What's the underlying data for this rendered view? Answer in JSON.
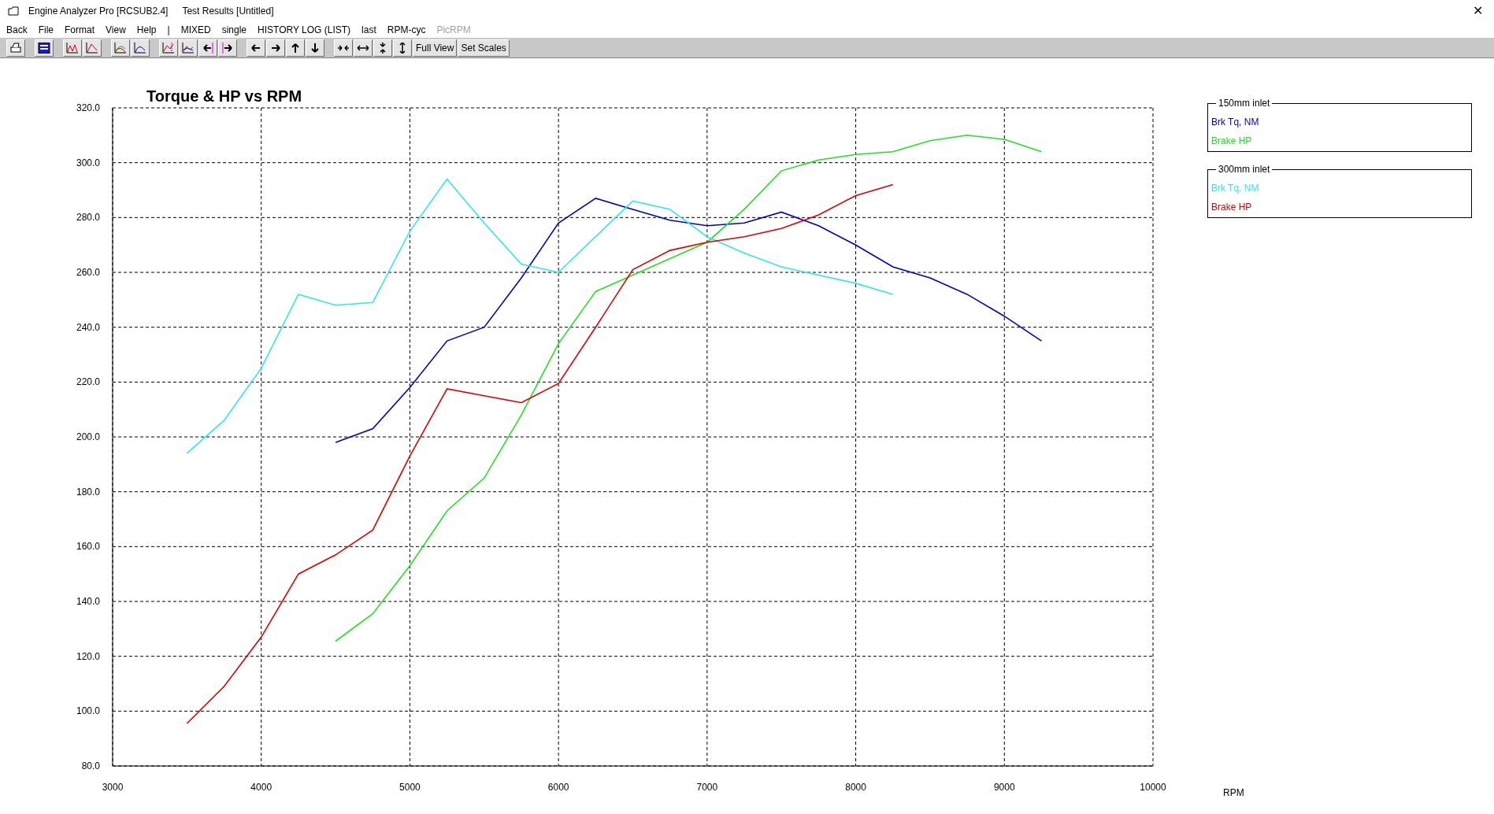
{
  "window": {
    "title": "Engine Analyzer Pro [RCSUB2.4]",
    "subtitle": "Test Results [Untitled]",
    "close": "✕"
  },
  "menu": [
    {
      "label": "Back",
      "disabled": false
    },
    {
      "label": "File",
      "disabled": false
    },
    {
      "label": "Format",
      "disabled": false
    },
    {
      "label": "View",
      "disabled": false
    },
    {
      "label": "Help",
      "disabled": false
    },
    {
      "label": "|",
      "disabled": false
    },
    {
      "label": "MIXED",
      "disabled": false
    },
    {
      "label": "single",
      "disabled": false
    },
    {
      "label": "HISTORY LOG (LIST)",
      "disabled": false
    },
    {
      "label": "last",
      "disabled": false
    },
    {
      "label": "RPM-cyc",
      "disabled": false
    },
    {
      "label": "PicRPM",
      "disabled": true
    }
  ],
  "toolbar": {
    "text_buttons": [
      "Full View",
      "Set Scales"
    ]
  },
  "legend_groups": [
    {
      "title": "150mm inlet"
    },
    {
      "title": "300mm inlet"
    }
  ],
  "chart_data": {
    "type": "line",
    "title": "Torque & HP vs RPM",
    "grid": true,
    "annotations": [
      {
        "text": "RPM"
      }
    ],
    "x": [
      3500,
      3750,
      4000,
      4250,
      4500,
      4750,
      5000,
      5250,
      5500,
      5750,
      6000,
      6250,
      6500,
      6750,
      7000,
      7250,
      7500,
      7750,
      8000,
      8250,
      8500,
      8750,
      9000,
      9250
    ],
    "series": [
      {
        "name": "Brk Tq, NM",
        "color": "#0000c8",
        "values": [
          null,
          null,
          null,
          null,
          198,
          203,
          218,
          235,
          240,
          258,
          278,
          287,
          283,
          279,
          277,
          278,
          282,
          277,
          270,
          262,
          258,
          252,
          244,
          235
        ]
      },
      {
        "name": "Brake HP",
        "color": "#22e022",
        "values": [
          null,
          null,
          null,
          null,
          125.5,
          135.5,
          153,
          173,
          185,
          208,
          234,
          253,
          259,
          265,
          271,
          283,
          297,
          301,
          303,
          304,
          308,
          310,
          308.5,
          304
        ]
      },
      {
        "name": "Brk Tq, NM",
        "color": "#33e6e6",
        "values": [
          194,
          206,
          225,
          252,
          248,
          249,
          275,
          294,
          278,
          263,
          260,
          273,
          286,
          283,
          273,
          267,
          262,
          259,
          256,
          252,
          null,
          null,
          null,
          null
        ]
      },
      {
        "name": "Brake HP",
        "color": "#e00000",
        "values": [
          95.5,
          109,
          127,
          150,
          157,
          166,
          193,
          217.5,
          215,
          212.5,
          219.5,
          240,
          261,
          268,
          271,
          273,
          276,
          281,
          288,
          292,
          null,
          null,
          null,
          null
        ]
      }
    ],
    "xlim": [
      3000,
      10000
    ],
    "ylim": [
      80,
      320
    ],
    "xticks": [
      3000,
      4000,
      5000,
      6000,
      7000,
      8000,
      9000,
      10000
    ],
    "yticks": [
      {
        "value": 80,
        "label": "80.0"
      },
      {
        "value": 100,
        "label": "100.0"
      },
      {
        "value": 120,
        "label": "120.0"
      },
      {
        "value": 140,
        "label": "140.0"
      },
      {
        "value": 160,
        "label": "160.0"
      },
      {
        "value": 180,
        "label": "180.0"
      },
      {
        "value": 200,
        "label": "200.0"
      },
      {
        "value": 220,
        "label": "220.0"
      },
      {
        "value": 240,
        "label": "240.0"
      },
      {
        "value": 260,
        "label": "260.0"
      },
      {
        "value": 280,
        "label": "280.0"
      },
      {
        "value": 300,
        "label": "300.0"
      },
      {
        "value": 320,
        "label": "320.0"
      }
    ]
  }
}
